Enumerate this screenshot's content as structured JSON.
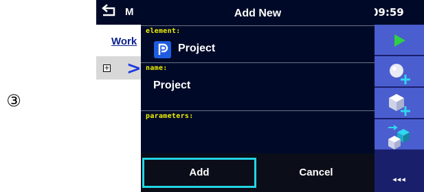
{
  "step_marker": "③",
  "topbar": {
    "title_fragment": "M",
    "clock": "09:59"
  },
  "background": {
    "link_text": "Work",
    "tree_expander": "+",
    "tree_chevron": ">"
  },
  "dialog": {
    "title": "Add New",
    "element_label": "element:",
    "element_value": "Project",
    "name_label": "name:",
    "name_value": "Project",
    "parameters_label": "parameters:",
    "add_button": "Add",
    "cancel_button": "Cancel"
  },
  "sidebar": {
    "more_label": "◂◂◂"
  },
  "colors": {
    "dialog_bg": "#000a28",
    "label_yellow": "#f0f000",
    "focus_cyan": "#23d6e6",
    "sidebar_button": "#4a5ecf",
    "accent_green": "#2fcf45"
  },
  "icons": {
    "topbar_back": "back-arrow-icon",
    "battery": "battery-icon",
    "project": "project-icon",
    "sidebar": [
      "start-play-icon",
      "add-sphere-icon",
      "add-cube-icon",
      "multi-cube-icon"
    ]
  }
}
